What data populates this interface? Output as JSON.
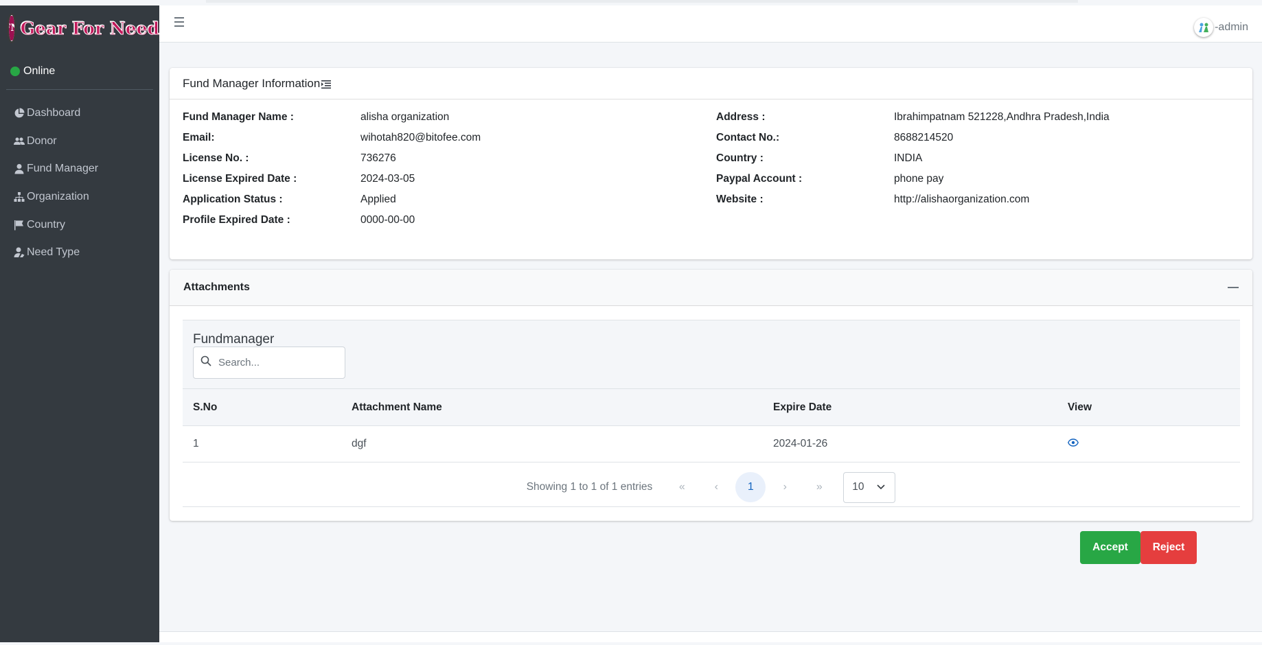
{
  "brand": {
    "name": "Gear For Need",
    "logo_text": "FN"
  },
  "sidebar": {
    "status": "Online",
    "items": [
      {
        "label": "Dashboard",
        "icon": "chart-pie-icon"
      },
      {
        "label": "Donor",
        "icon": "users-icon"
      },
      {
        "label": "Fund Manager",
        "icon": "user-tie-icon"
      },
      {
        "label": "Organization",
        "icon": "sitemap-icon"
      },
      {
        "label": "Country",
        "icon": "flag-icon"
      },
      {
        "label": "Need Type",
        "icon": "user-hand-icon"
      }
    ]
  },
  "header": {
    "user": "-admin"
  },
  "info": {
    "title": "Fund Manager Information",
    "left": [
      {
        "label": "Fund Manager Name :",
        "value": "alisha organization"
      },
      {
        "label": "Email:",
        "value": "wihotah820@bitofee.com"
      },
      {
        "label": "License No. :",
        "value": "736276"
      },
      {
        "label": "License Expired Date :",
        "value": "2024-03-05"
      },
      {
        "label": "Application Status :",
        "value": "Applied"
      },
      {
        "label": "Profile Expired Date :",
        "value": "0000-00-00"
      }
    ],
    "right": [
      {
        "label": "Address :",
        "value": "Ibrahimpatnam 521228,Andhra Pradesh,India"
      },
      {
        "label": "Contact No.:",
        "value": "8688214520"
      },
      {
        "label": "Country :",
        "value": "INDIA"
      },
      {
        "label": "Paypal Account :",
        "value": "phone pay"
      },
      {
        "label": "Website :",
        "value": "http://alishaorganization.com"
      }
    ]
  },
  "attachments": {
    "title": "Attachments",
    "table_title": "Fundmanager",
    "search_placeholder": "Search...",
    "columns": [
      "S.No",
      "Attachment Name",
      "Expire Date",
      "View"
    ],
    "rows": [
      {
        "sno": "1",
        "name": "dgf",
        "expire": "2024-01-26"
      }
    ],
    "pagination": {
      "info": "Showing 1 to 1 of 1 entries",
      "current_page": "1",
      "page_size": "10"
    }
  },
  "actions": {
    "accept": "Accept",
    "reject": "Reject"
  },
  "colors": {
    "sidebar_bg": "#343a40",
    "accept": "#28a745",
    "reject": "#e53e3e",
    "online": "#28a745"
  }
}
